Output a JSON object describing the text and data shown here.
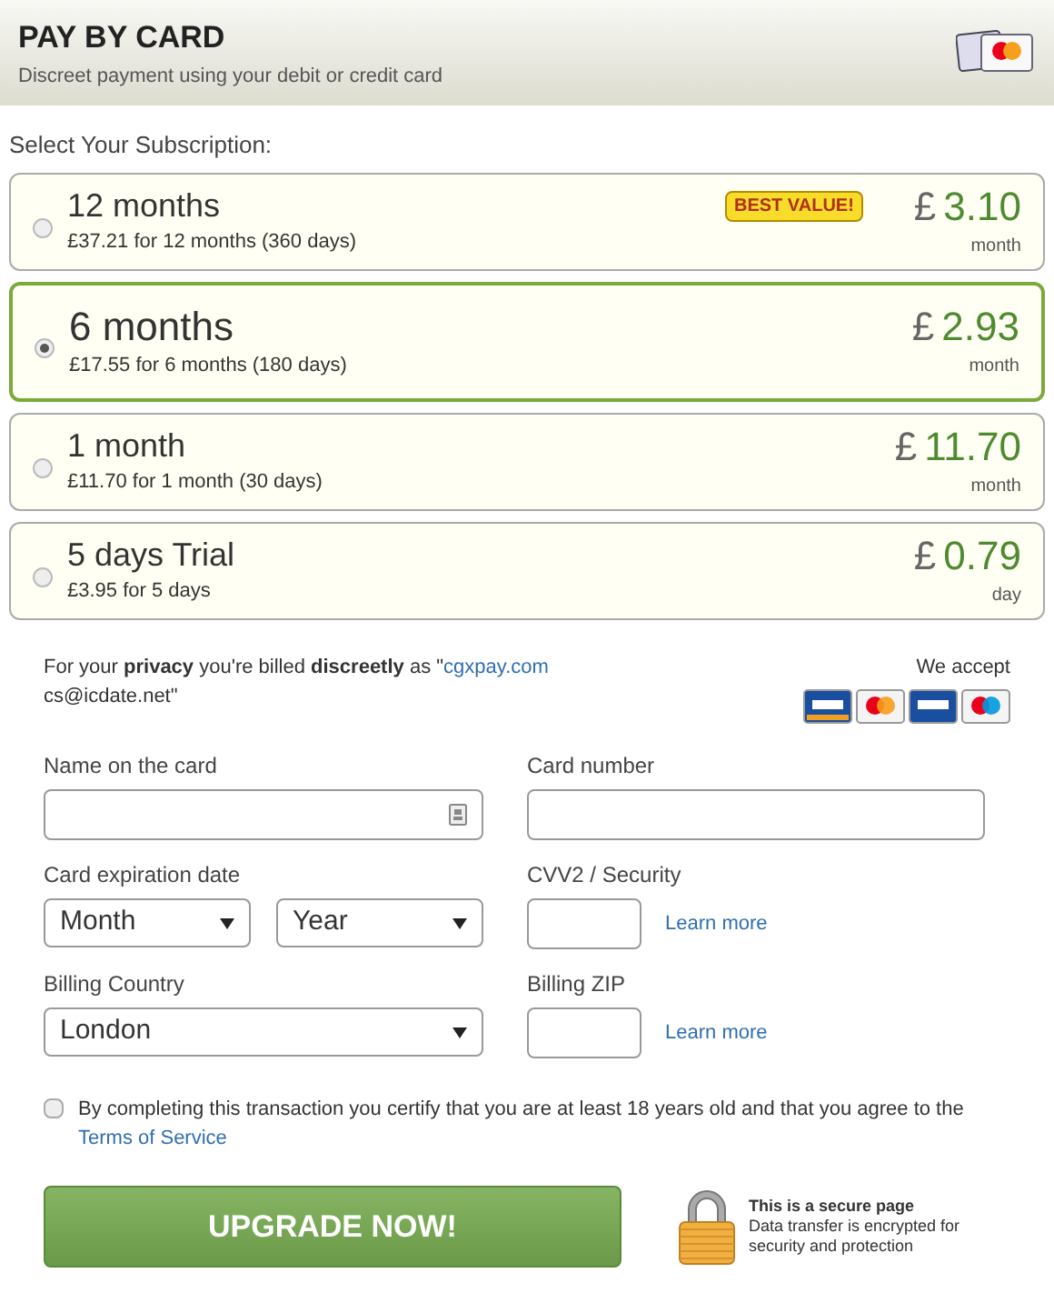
{
  "header": {
    "title": "PAY BY CARD",
    "subtitle": "Discreet payment using your debit or credit card"
  },
  "subscription_label": "Select Your Subscription:",
  "plans": [
    {
      "name": "12 months",
      "detail": "£37.21 for 12 months (360 days)",
      "badge": "BEST VALUE!",
      "currency": "£",
      "price": "3.10",
      "unit": "month",
      "selected": false
    },
    {
      "name": "6 months",
      "detail": "£17.55 for 6 months (180 days)",
      "currency": "£",
      "price": "2.93",
      "unit": "month",
      "selected": true
    },
    {
      "name": "1 month",
      "detail": "£11.70 for 1 month (30 days)",
      "currency": "£",
      "price": "11.70",
      "unit": "month",
      "selected": false
    },
    {
      "name": "5 days Trial",
      "detail": "£3.95 for 5 days",
      "currency": "£",
      "price": "0.79",
      "unit": "day",
      "selected": false
    }
  ],
  "privacy": {
    "text": "For your **privacy** you're billed **discreetly** as \"",
    "link": "cgxpay.com",
    "after": "cs@icdate.net\""
  },
  "we_accept": "We accept",
  "form": {
    "name_label": "Name on the card",
    "card_number_label": "Card number",
    "expiry_label": "Card expiration date",
    "month": "Month",
    "year": "Year",
    "cvv_label": "CVV2 / Security",
    "cvv_help": "Learn more",
    "country_label": "Billing Country",
    "country": "London",
    "zip_label": "Billing ZIP",
    "zip_help": "Learn more"
  },
  "terms": {
    "checked": false,
    "text": "By completing this transaction you certify that you are at least 18 years old and that you agree to the ",
    "link": "Terms of Service"
  },
  "button": "UPGRADE NOW!",
  "secure": {
    "title": "This is a secure page",
    "text": "Data transfer is encrypted for security and protection"
  }
}
